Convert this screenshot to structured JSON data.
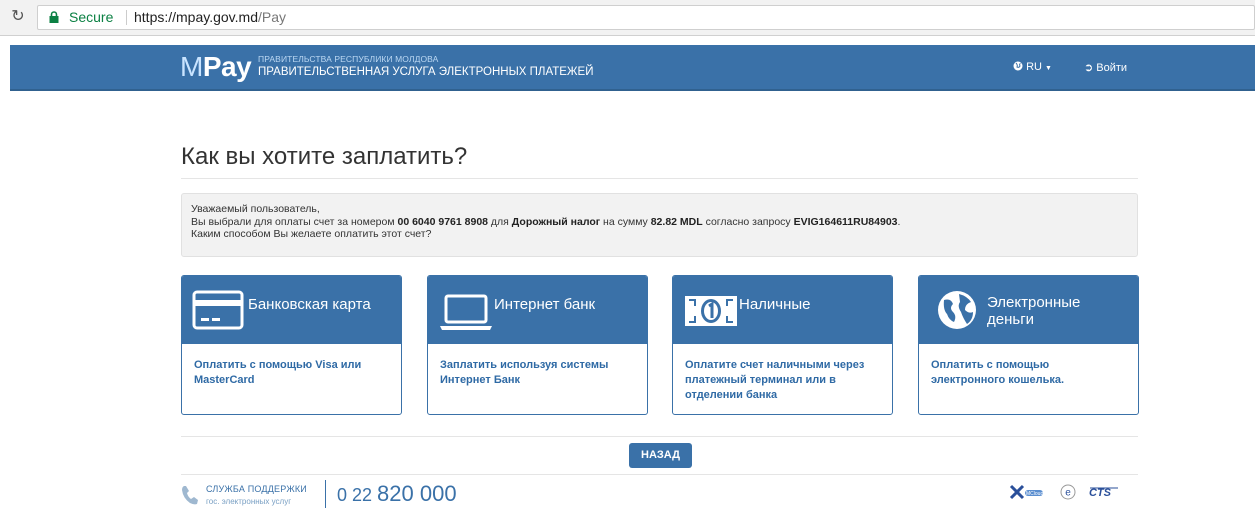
{
  "browser": {
    "secure_label": "Secure",
    "url_host": "https://mpay.gov.md",
    "url_path": "/Pay"
  },
  "header": {
    "logo_m": "M",
    "logo_pay": "Pay",
    "gov_small": "ПРАВИТЕЛЬСТВА РЕСПУБЛИКИ МОЛДОВА",
    "gov_big": "ПРАВИТЕЛЬСТВЕННАЯ УСЛУГА ЭЛЕКТРОННЫХ ПЛАТЕЖЕЙ",
    "language": "RU",
    "login": "Войти"
  },
  "main": {
    "title": "Как вы хотите заплатить?",
    "notice": {
      "greeting": "Уважаемый пользователь,",
      "line2_a": "Вы выбрали для оплаты счет за номером ",
      "invoice_number": "00 6040 9761 8908",
      "line2_b": " для ",
      "service": "Дорожный налог",
      "line2_c": " на сумму ",
      "amount": "82.82 MDL",
      "line2_d": " согласно запросу ",
      "request_id": "EVIG164611RU84903",
      "line2_e": ".",
      "question": "Каким способом Вы желаете оплатить этот счет?"
    },
    "methods": [
      {
        "title": "Банковская карта",
        "description": "Оплатить с помощью Visa или MasterCard",
        "icon": "credit-card-icon"
      },
      {
        "title": "Интернет банк",
        "description": "Заплатить используя системы Интернет Банк",
        "icon": "laptop-icon"
      },
      {
        "title": "Наличные",
        "description": "Оплатите счет наличными через платежный терминал или в отделении банка",
        "icon": "cash-icon"
      },
      {
        "title": "Электронные деньги",
        "description": "Оплатить с помощью электронного кошелька.",
        "icon": "globe-icon"
      }
    ],
    "back_button": "НАЗАД"
  },
  "footer": {
    "support_label": "СЛУЖБА ПОДДЕРЖКИ",
    "support_sub": "гос. электронных услуг",
    "phone_prefix": "0 22 ",
    "phone_number": "820 000",
    "partner_labels": [
      "MCloud",
      "e",
      "CTS"
    ]
  },
  "colors": {
    "brand_blue": "#3a71a8",
    "secure_green": "#0b8043"
  }
}
